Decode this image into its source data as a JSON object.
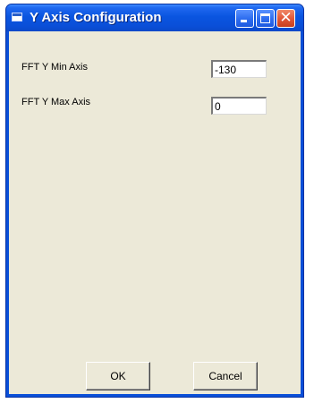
{
  "window": {
    "title": "Y Axis Configuration",
    "controls": [
      "minimize",
      "maximize",
      "close"
    ]
  },
  "form": {
    "fft_y_min_label": "FFT Y Min Axis",
    "fft_y_min_value": "-130",
    "fft_y_max_label": "FFT Y Max Axis",
    "fft_y_max_value": "0"
  },
  "buttons": {
    "ok_label": "OK",
    "cancel_label": "Cancel"
  },
  "colors": {
    "titlebar": "#0a4fd8",
    "client_background": "#ece9d8",
    "close_button": "#e2583a"
  }
}
